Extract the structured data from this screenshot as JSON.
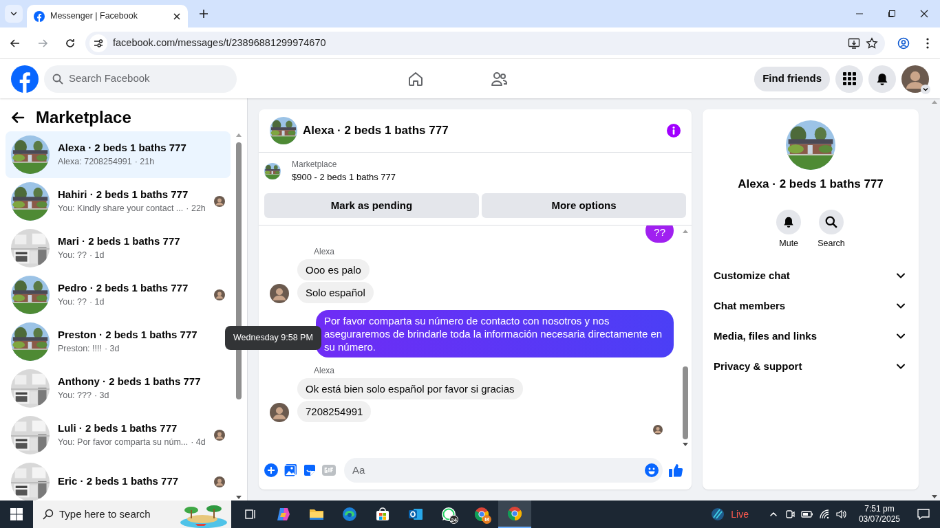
{
  "browser": {
    "tab_title": "Messenger | Facebook",
    "url": "facebook.com/messages/t/23896881299974670"
  },
  "header": {
    "search_placeholder": "Search Facebook",
    "find_friends": "Find friends"
  },
  "sidebar": {
    "title": "Marketplace",
    "conversations": [
      {
        "name": "Alexa · 2 beds 1 baths 777",
        "preview": "Alexa: 7208254991",
        "time": "· 21h",
        "selected": true,
        "seen": false
      },
      {
        "name": "Hahiri · 2 beds 1 baths 777",
        "preview": "You: Kindly share your contact ...",
        "time": "· 22h",
        "selected": false,
        "seen": true
      },
      {
        "name": "Mari · 2 beds 1 baths 777",
        "preview": "You: ??",
        "time": "· 1d",
        "selected": false,
        "seen": false
      },
      {
        "name": "Pedro · 2 beds 1 baths 777",
        "preview": "You: ??",
        "time": "· 1d",
        "selected": false,
        "seen": true
      },
      {
        "name": "Preston · 2 beds 1 baths 777",
        "preview": "Preston: !!!!",
        "time": "· 3d",
        "selected": false,
        "seen": false
      },
      {
        "name": "Anthony · 2 beds 1 baths 777",
        "preview": "You: ???",
        "time": "· 3d",
        "selected": false,
        "seen": false
      },
      {
        "name": "Luli · 2 beds 1 baths 777",
        "preview": "You: Por favor comparta su núm...",
        "time": "· 4d",
        "selected": false,
        "seen": true
      },
      {
        "name": "Eric · 2 beds 1 baths 777",
        "selected": false,
        "seen": true
      }
    ]
  },
  "chat": {
    "title": "Alexa · 2 beds 1 baths 777",
    "listing": {
      "label": "Marketplace",
      "title": "$900 - 2 beds 1 baths 777",
      "buttons": [
        "Mark as pending",
        "More options"
      ]
    },
    "messages": [
      {
        "kind": "outgoing",
        "text": "??"
      },
      {
        "kind": "sender",
        "text": "Alexa"
      },
      {
        "kind": "incoming",
        "text": "Ooo es palo",
        "avatar": false
      },
      {
        "kind": "incoming",
        "text": "Solo español",
        "avatar": true
      },
      {
        "kind": "outgoing",
        "text": "Por favor comparta su número de contacto con nosotros y nos aseguraremos de brindarle toda la información necesaria directamente en su número."
      },
      {
        "kind": "sender",
        "text": "Alexa"
      },
      {
        "kind": "incoming",
        "text": "Ok está bien solo español por favor si gracias",
        "avatar": false
      },
      {
        "kind": "incoming",
        "text": "7208254991",
        "avatar": true
      }
    ],
    "read_receipt": true,
    "tooltip": "Wednesday 9:58 PM",
    "composer_placeholder": "Aa"
  },
  "details": {
    "title": "Alexa · 2 beds 1 baths 777",
    "actions": [
      {
        "kind": "mute",
        "label": "Mute"
      },
      {
        "kind": "search",
        "label": "Search"
      }
    ],
    "sections": [
      {
        "label": "Customize chat",
        "expanded": false
      },
      {
        "label": "Chat members",
        "expanded": false
      },
      {
        "label": "Media, files and links",
        "expanded": false
      },
      {
        "label": "Privacy & support",
        "expanded": false
      }
    ]
  },
  "taskbar": {
    "search_placeholder": "Type here to search",
    "apps": [
      {
        "kind": "taskview",
        "selected": false
      },
      {
        "kind": "copilot",
        "selected": false
      },
      {
        "kind": "explorer",
        "selected": false
      },
      {
        "kind": "edge",
        "selected": false
      },
      {
        "kind": "store",
        "selected": false
      },
      {
        "kind": "outlook",
        "selected": false
      },
      {
        "kind": "whatsapp",
        "badge": "24",
        "selected": false
      },
      {
        "kind": "chrome",
        "badge": "M",
        "selected": false
      },
      {
        "kind": "chrome",
        "selected": true
      }
    ],
    "weather": "Live",
    "time": "7:51 pm",
    "date": "03/07/2025"
  }
}
